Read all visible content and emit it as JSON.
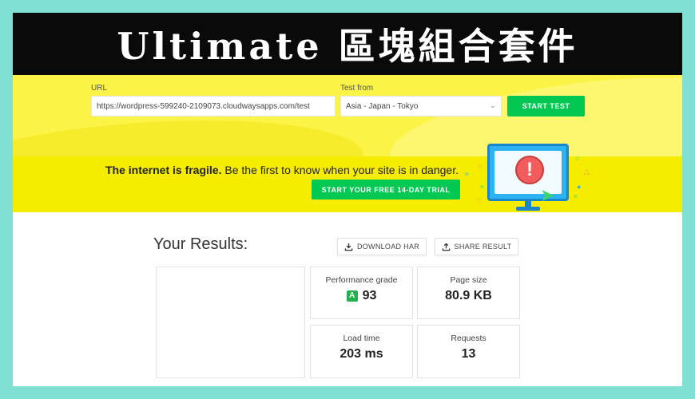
{
  "banner_title": "Ultimate 區塊組合套件",
  "form": {
    "url_label": "URL",
    "url_value": "https://wordpress-599240-2109073.cloudwaysapps.com/test",
    "region_label": "Test from",
    "region_value": "Asia - Japan - Tokyo",
    "start_button": "START TEST"
  },
  "promo": {
    "bold_text": "The internet is fragile.",
    "text": " Be the first to know when your site is in danger.",
    "trial_button": "START YOUR FREE 14-DAY TRIAL",
    "alert_glyph": "!"
  },
  "results": {
    "title": "Your Results:",
    "download_button": "DOWNLOAD HAR",
    "share_button": "SHARE RESULT",
    "metrics": [
      {
        "label": "Performance grade",
        "grade": "A",
        "value": "93"
      },
      {
        "label": "Page size",
        "value": "80.9 KB"
      },
      {
        "label": "Load time",
        "value": "203 ms"
      },
      {
        "label": "Requests",
        "value": "13"
      }
    ]
  },
  "colors": {
    "accent_green": "#00c853",
    "banner_yellow": "#f6ec00",
    "page_border": "#7fe0d3"
  }
}
